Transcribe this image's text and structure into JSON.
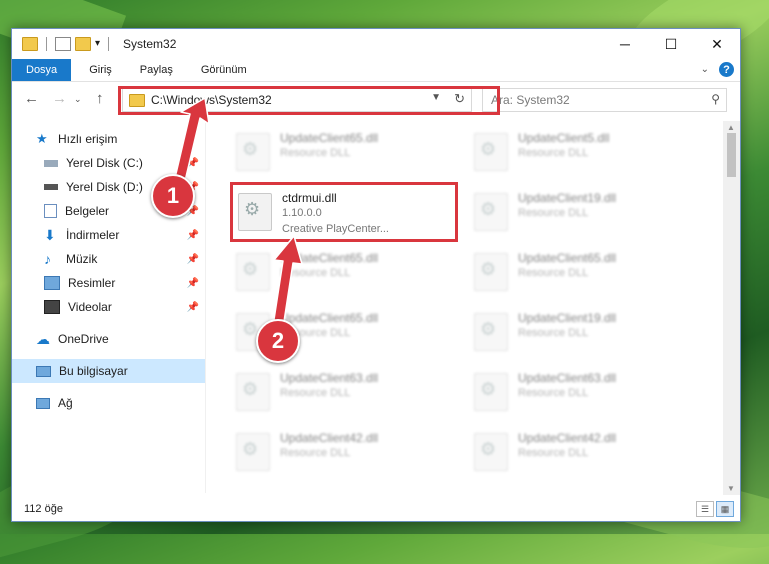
{
  "window": {
    "title": "System32",
    "controls": {
      "minimize": "─",
      "maximize": "☐",
      "close": "✕"
    }
  },
  "ribbon": {
    "tabs": [
      "Dosya",
      "Giriş",
      "Paylaş",
      "Görünüm"
    ],
    "help": "?"
  },
  "address": {
    "path": "C:\\Windows\\System32",
    "search_placeholder": "Ara: System32"
  },
  "nav": {
    "quick_access": "Hızlı erişim",
    "items": [
      {
        "label": "Yerel Disk (C:)",
        "icon": "drive-icon"
      },
      {
        "label": "Yerel Disk (D:)",
        "icon": "drive-icon"
      },
      {
        "label": "Belgeler",
        "icon": "documents-icon"
      },
      {
        "label": "İndirmeler",
        "icon": "downloads-icon"
      },
      {
        "label": "Müzik",
        "icon": "music-icon"
      },
      {
        "label": "Resimler",
        "icon": "pictures-icon"
      },
      {
        "label": "Videolar",
        "icon": "videos-icon"
      }
    ],
    "onedrive": "OneDrive",
    "this_pc": "Bu bilgisayar",
    "network": "Ağ"
  },
  "files": {
    "left": [
      {
        "name": "UpdateClient65.dll",
        "sub": "Resource DLL"
      },
      {
        "name": "ctdrmui.dll",
        "sub": "1.10.0.0",
        "sub2": "Creative PlayCenter..."
      },
      {
        "name": "UpdateClient65.dll",
        "sub": "Resource DLL"
      },
      {
        "name": "UpdateClient65.dll",
        "sub": "Resource DLL"
      },
      {
        "name": "UpdateClient63.dll",
        "sub": "Resource DLL"
      },
      {
        "name": "UpdateClient42.dll",
        "sub": "Resource DLL"
      }
    ],
    "right": [
      {
        "name": "UpdateClient5.dll",
        "sub": "Resource DLL"
      },
      {
        "name": "UpdateClient19.dll",
        "sub": "Resource DLL"
      },
      {
        "name": "UpdateClient65.dll",
        "sub": "Resource DLL"
      },
      {
        "name": "UpdateClient19.dll",
        "sub": "Resource DLL"
      },
      {
        "name": "UpdateClient63.dll",
        "sub": "Resource DLL"
      },
      {
        "name": "UpdateClient42.dll",
        "sub": "Resource DLL"
      }
    ]
  },
  "status": {
    "count": "112 öğe"
  },
  "annotations": {
    "step1": "1",
    "step2": "2",
    "color": "#d9363e"
  }
}
